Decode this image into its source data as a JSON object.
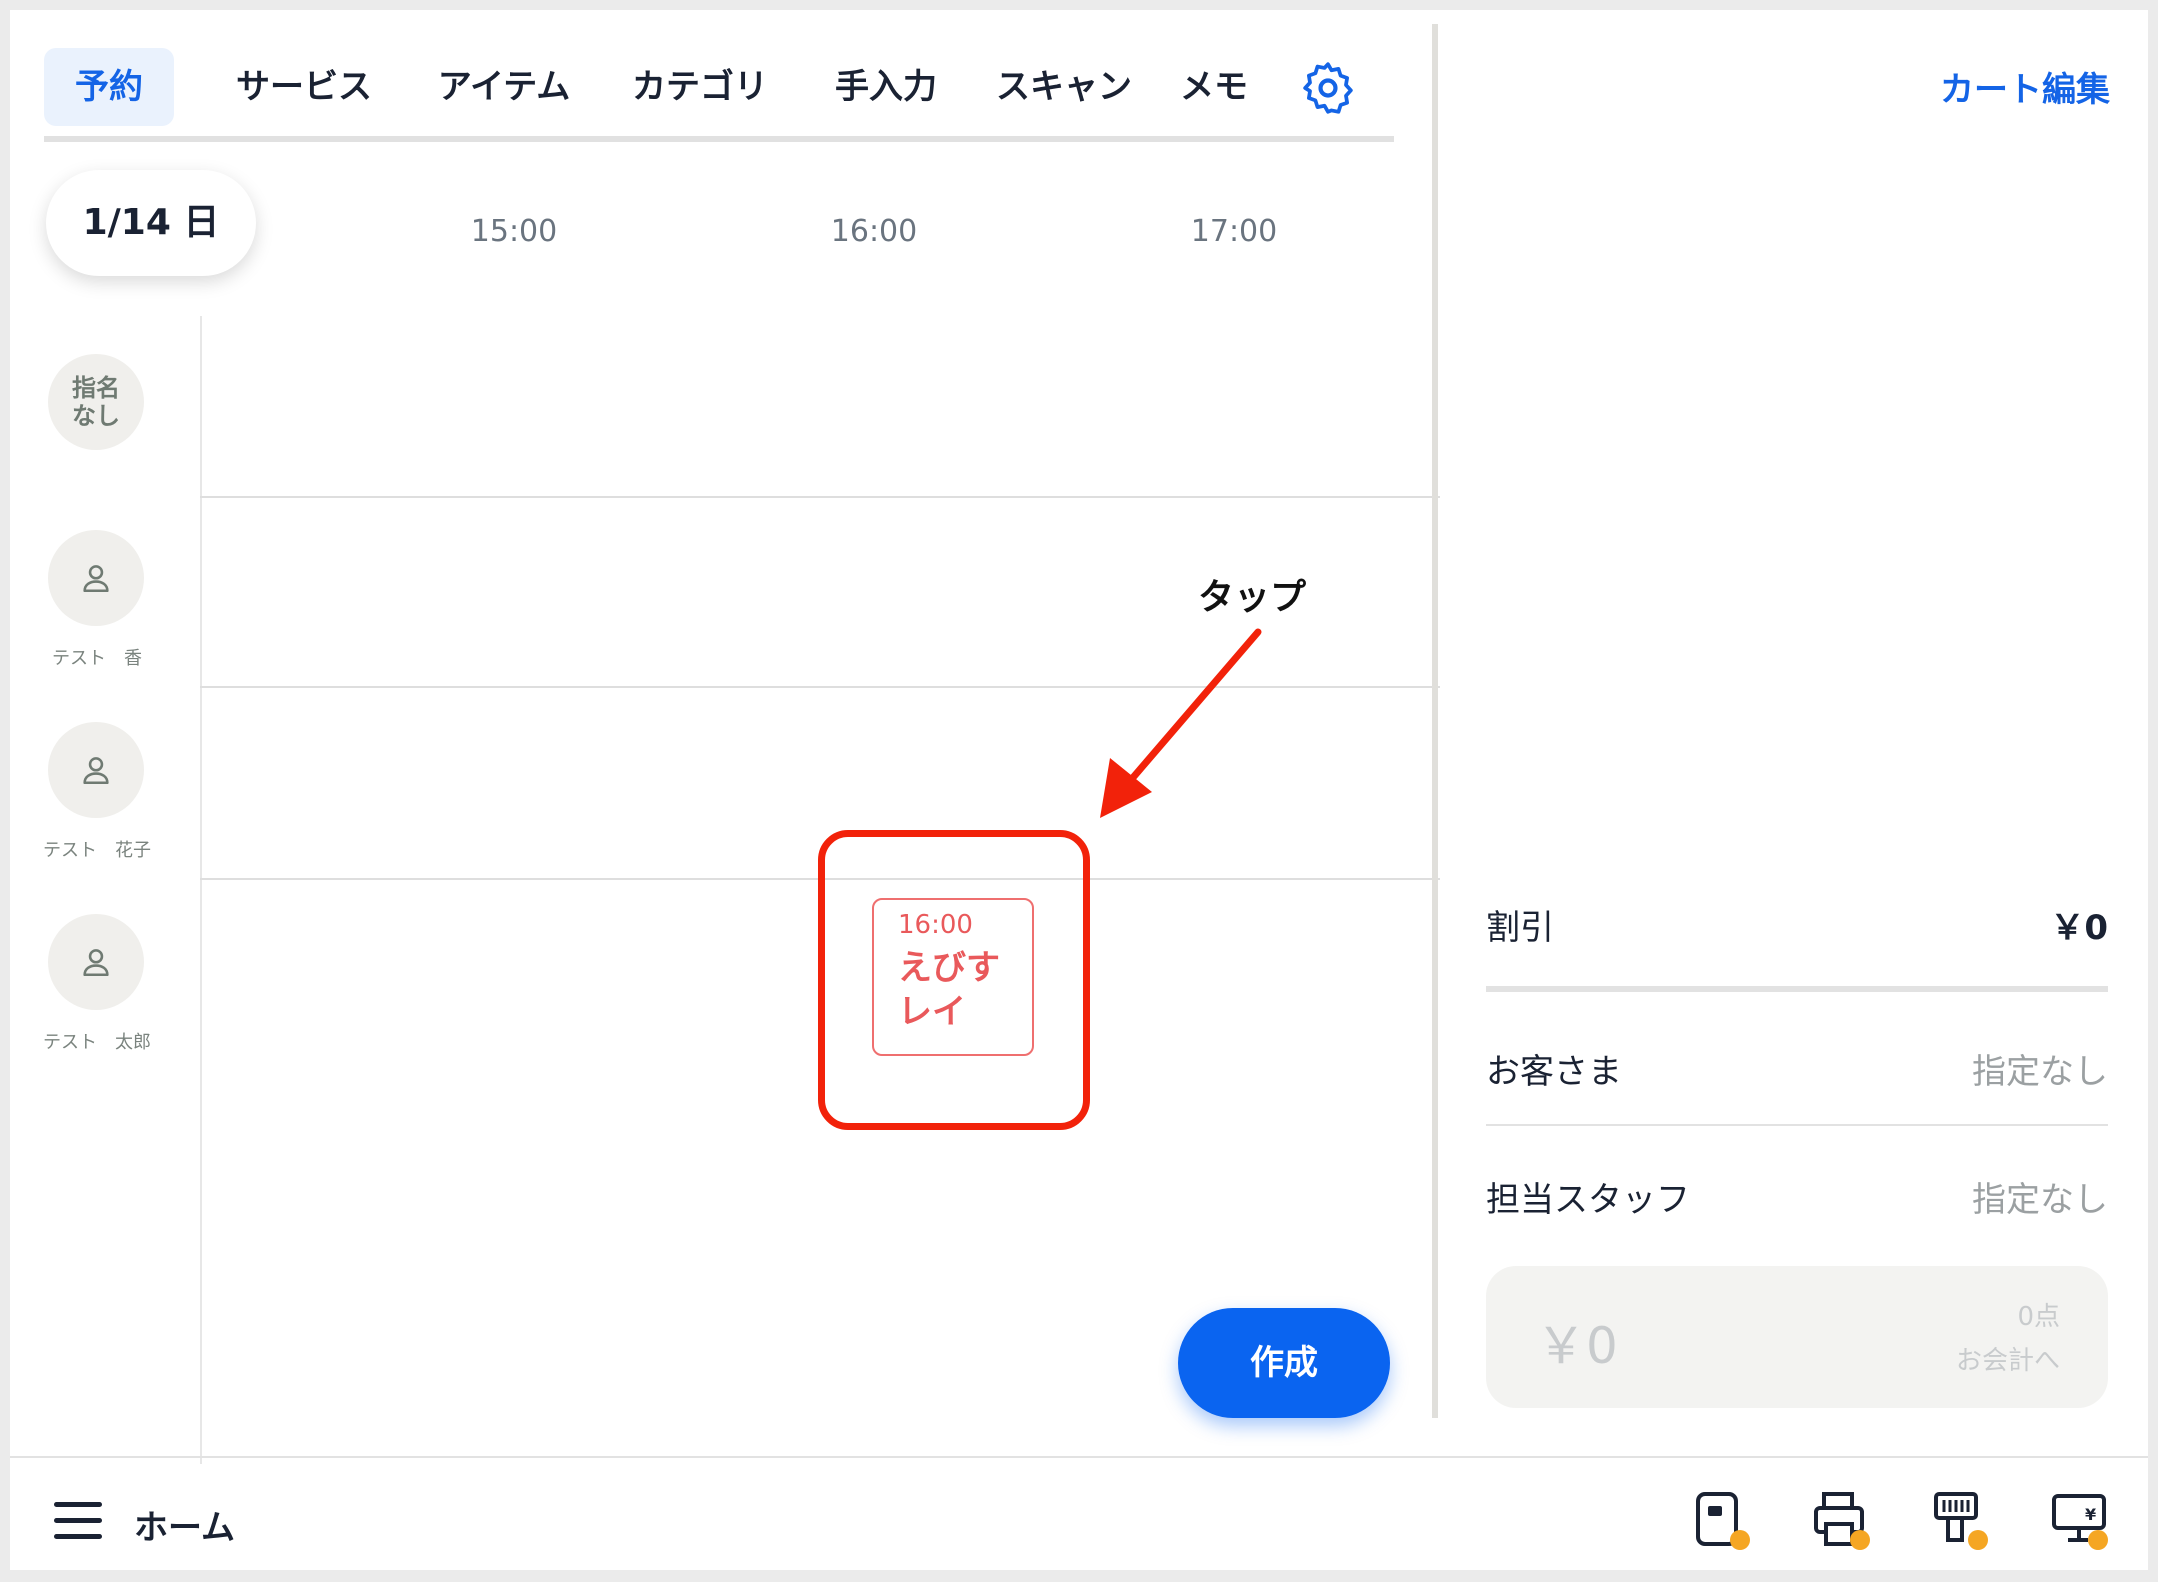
{
  "tabs": [
    {
      "label": "予約",
      "active": true
    },
    {
      "label": "サービス"
    },
    {
      "label": "アイテム"
    },
    {
      "label": "カテゴリ"
    },
    {
      "label": "手入力"
    },
    {
      "label": "スキャン"
    },
    {
      "label": "メモ"
    }
  ],
  "date": "1/14 日",
  "times": [
    "15:00",
    "16:00",
    "17:00"
  ],
  "staff": [
    {
      "label": "指名\nなし"
    },
    {
      "name": "テスト　香"
    },
    {
      "name": "テスト　花子"
    },
    {
      "name": "テスト　太郎"
    }
  ],
  "appointment": {
    "time": "16:00",
    "name": "えびすレイ"
  },
  "annotation": {
    "label": "タップ"
  },
  "create_label": "作成",
  "right_panel": {
    "cart_edit": "カート編集",
    "discount_label": "割引",
    "discount_value": "￥0",
    "customer_label": "お客さま",
    "customer_value": "指定なし",
    "staff_label": "担当スタッフ",
    "staff_value": "指定なし",
    "total": "￥0",
    "count": "0点",
    "checkout_label": "お会計へ"
  },
  "bottom": {
    "home_label": "ホーム"
  },
  "colors": {
    "accent": "#0a64f0",
    "appointment": "#e9595b",
    "annotation": "#f2220a"
  }
}
